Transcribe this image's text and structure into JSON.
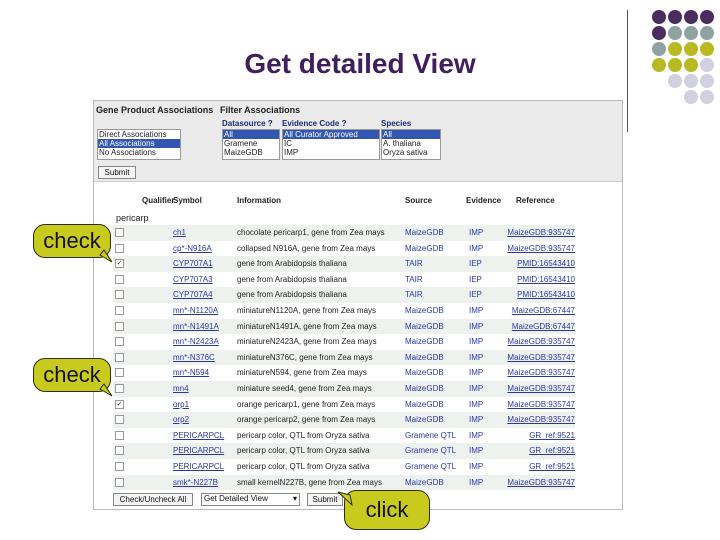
{
  "slide": {
    "title": "Get detailed View",
    "palette": [
      "#4a2d5e",
      "#8ea3a1",
      "#b9b923",
      "#d0d0e0"
    ]
  },
  "filters": {
    "gene_product_associations_label": "Gene Product Associations",
    "filter_associations_label": "Filter Associations",
    "association_options": [
      "Direct Associations",
      "All Associations",
      "No Associations"
    ],
    "association_selected_index": 1,
    "datasource_label": "Datasource ?",
    "datasource_options": [
      "All",
      "Gramene",
      "MaizeGDB"
    ],
    "evidence_label": "Evidence Code ?",
    "evidence_options": [
      "All Curator Approved",
      "IC",
      "IMP"
    ],
    "species_label": "Species",
    "species_options": [
      "All",
      "A. thaliana",
      "Oryza sativa"
    ],
    "submit_label": "Submit"
  },
  "table": {
    "headers": {
      "qualifier": "Qualifier",
      "symbol": "Symbol",
      "information": "Information",
      "source": "Source",
      "evidence": "Evidence",
      "reference": "Reference"
    },
    "category": "pericarp",
    "rows": [
      {
        "checked": false,
        "symbol": "ch1",
        "info": "chocolate pericarp1, gene from Zea mays",
        "source": "MaizeGDB",
        "evidence": "IMP",
        "reference": "MaizeGDB:935747"
      },
      {
        "checked": false,
        "symbol": "cp*-N916A",
        "info": "collapsed N916A, gene from Zea mays",
        "source": "MaizeGDB",
        "evidence": "IMP",
        "reference": "MaizeGDB:935747"
      },
      {
        "checked": true,
        "symbol": "CYP707A1",
        "info": "gene from Arabidopsis thaliana",
        "source": "TAIR",
        "evidence": "IEP",
        "reference": "PMID:16543410"
      },
      {
        "checked": false,
        "symbol": "CYP707A3",
        "info": "gene from Arabidopsis thaliana",
        "source": "TAIR",
        "evidence": "IEP",
        "reference": "PMID:16543410"
      },
      {
        "checked": false,
        "symbol": "CYP707A4",
        "info": "gene from Arabidopsis thaliana",
        "source": "TAIR",
        "evidence": "IEP",
        "reference": "PMID:16543410"
      },
      {
        "checked": false,
        "symbol": "mn*-N1120A",
        "info": "miniatureN1120A, gene from Zea mays",
        "source": "MaizeGDB",
        "evidence": "IMP",
        "reference": "MaizeGDB:67447"
      },
      {
        "checked": false,
        "symbol": "mn*-N1491A",
        "info": "miniatureN1491A, gene from Zea mays",
        "source": "MaizeGDB",
        "evidence": "IMP",
        "reference": "MaizeGDB:67447"
      },
      {
        "checked": false,
        "symbol": "mn*-N2423A",
        "info": "miniatureN2423A, gene from Zea mays",
        "source": "MaizeGDB",
        "evidence": "IMP",
        "reference": "MaizeGDB:935747"
      },
      {
        "checked": false,
        "symbol": "mn*-N376C",
        "info": "miniatureN376C, gene from Zea mays",
        "source": "MaizeGDB",
        "evidence": "IMP",
        "reference": "MaizeGDB:935747"
      },
      {
        "checked": false,
        "symbol": "mn*-N594",
        "info": "miniatureN594, gene from Zea mays",
        "source": "MaizeGDB",
        "evidence": "IMP",
        "reference": "MaizeGDB:935747"
      },
      {
        "checked": false,
        "symbol": "mn4",
        "info": "miniature seed4, gene from Zea mays",
        "source": "MaizeGDB",
        "evidence": "IMP",
        "reference": "MaizeGDB:935747"
      },
      {
        "checked": true,
        "symbol": "orp1",
        "info": "orange pericarp1, gene from Zea mays",
        "source": "MaizeGDB",
        "evidence": "IMP",
        "reference": "MaizeGDB:935747"
      },
      {
        "checked": false,
        "symbol": "orp2",
        "info": "orange pericarp2, gene from Zea mays",
        "source": "MaizeGDB",
        "evidence": "IMP",
        "reference": "MaizeGDB:935747"
      },
      {
        "checked": false,
        "symbol": "PERICARPCL",
        "info": "pericarp color, QTL from Oryza sativa",
        "source": "Gramene QTL",
        "evidence": "IMP",
        "reference": "GR_ref:9521"
      },
      {
        "checked": false,
        "symbol": "PERICARPCL",
        "info": "pericarp color, QTL from Oryza sativa",
        "source": "Gramene QTL",
        "evidence": "IMP",
        "reference": "GR_ref:9521"
      },
      {
        "checked": false,
        "symbol": "PERICARPCL",
        "info": "pericarp color, QTL from Oryza sativa",
        "source": "Gramene QTL",
        "evidence": "IMP",
        "reference": "GR_ref:9521"
      },
      {
        "checked": false,
        "symbol": "smk*-N227B",
        "info": "small kernelN227B, gene from Zea mays",
        "source": "MaizeGDB",
        "evidence": "IMP",
        "reference": "MaizeGDB:935747"
      }
    ]
  },
  "bottom": {
    "check_uncheck_label": "Check/Uncheck All",
    "view_select_value": "Get Detailed View",
    "submit_label": "Submit"
  },
  "callouts": {
    "check_1": "check",
    "check_2": "check",
    "click": "click"
  }
}
